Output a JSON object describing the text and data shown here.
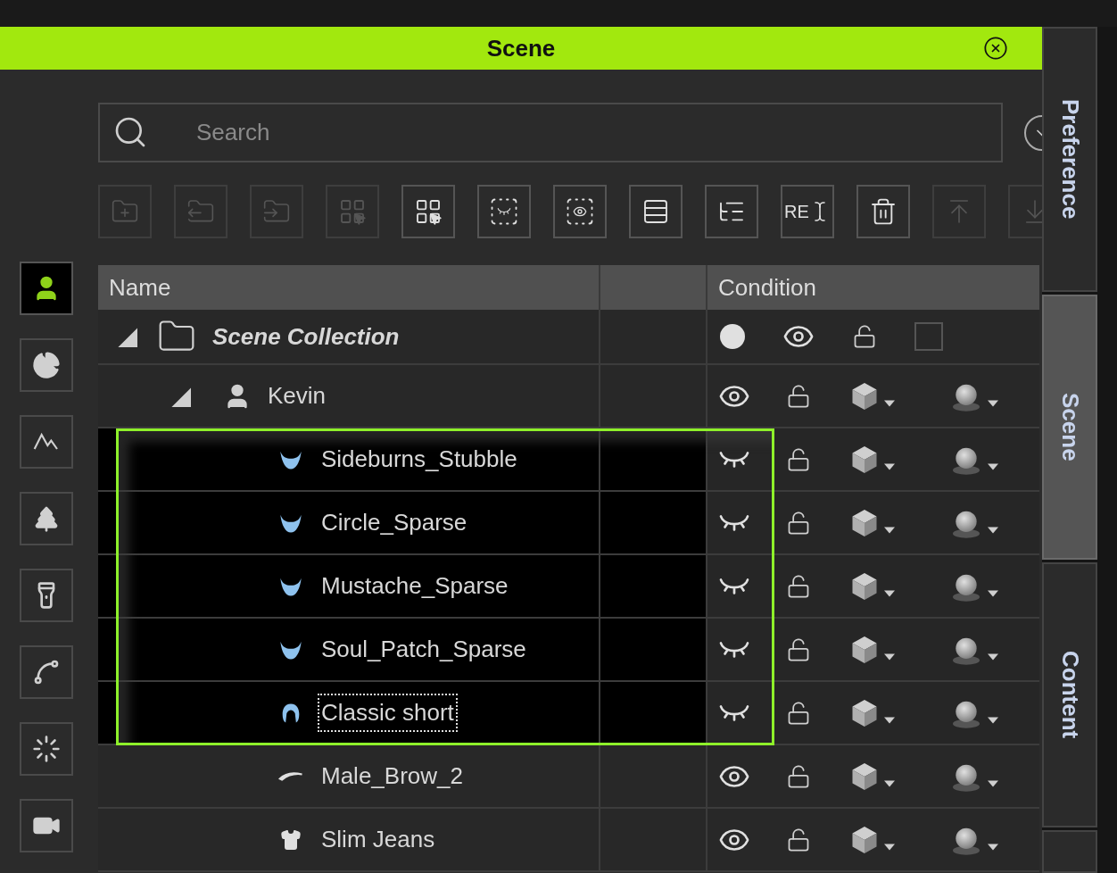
{
  "panel": {
    "title": "Scene"
  },
  "search": {
    "placeholder": "Search"
  },
  "toolbar": [
    {
      "kind": "new-folder",
      "disabled": true
    },
    {
      "kind": "move-out",
      "disabled": true
    },
    {
      "kind": "move-in",
      "disabled": true
    },
    {
      "kind": "select-grid",
      "disabled": true
    },
    {
      "kind": "select-grid",
      "disabled": false
    },
    {
      "kind": "hide",
      "disabled": false
    },
    {
      "kind": "show",
      "disabled": false
    },
    {
      "kind": "collapse",
      "disabled": false
    },
    {
      "kind": "expand",
      "disabled": false
    },
    {
      "kind": "rename",
      "label": "RE",
      "disabled": false
    },
    {
      "kind": "delete",
      "disabled": false
    },
    {
      "kind": "move-top",
      "disabled": true
    },
    {
      "kind": "move-bottom",
      "disabled": true
    }
  ],
  "rail": [
    {
      "kind": "avatar",
      "selected": true
    },
    {
      "kind": "props",
      "selected": false
    },
    {
      "kind": "terrain",
      "selected": false
    },
    {
      "kind": "tree",
      "selected": false
    },
    {
      "kind": "light",
      "selected": false
    },
    {
      "kind": "path",
      "selected": false
    },
    {
      "kind": "particle",
      "selected": false
    },
    {
      "kind": "camera",
      "selected": false
    }
  ],
  "side_tabs": [
    {
      "label": "Preference",
      "selected": false
    },
    {
      "label": "Scene",
      "selected": true
    },
    {
      "label": "Content",
      "selected": false
    }
  ],
  "table": {
    "columns": [
      {
        "label": "Name"
      },
      {
        "label": "Condition"
      }
    ],
    "tree": {
      "name": "Scene Collection",
      "kind": "collection",
      "expanded": true,
      "selected": false,
      "focused": false,
      "visible": true,
      "locked": false,
      "checked": false,
      "children": [
        {
          "name": "Kevin",
          "kind": "avatar",
          "expanded": true,
          "selected": false,
          "focused": false,
          "visible": true,
          "locked": false,
          "children": [
            {
              "name": "Sideburns_Stubble",
              "kind": "beard",
              "selected": true,
              "focused": false,
              "visible": false,
              "locked": false
            },
            {
              "name": "Circle_Sparse",
              "kind": "beard",
              "selected": true,
              "focused": false,
              "visible": false,
              "locked": false
            },
            {
              "name": "Mustache_Sparse",
              "kind": "beard",
              "selected": true,
              "focused": false,
              "visible": false,
              "locked": false
            },
            {
              "name": "Soul_Patch_Sparse",
              "kind": "beard",
              "selected": true,
              "focused": false,
              "visible": false,
              "locked": false
            },
            {
              "name": "Classic short",
              "kind": "hair",
              "selected": true,
              "focused": true,
              "visible": false,
              "locked": false
            },
            {
              "name": "Male_Brow_2",
              "kind": "brow",
              "selected": false,
              "focused": false,
              "visible": true,
              "locked": false
            },
            {
              "name": "Slim Jeans",
              "kind": "cloth",
              "selected": false,
              "focused": false,
              "visible": true,
              "locked": false
            }
          ]
        }
      ]
    }
  }
}
